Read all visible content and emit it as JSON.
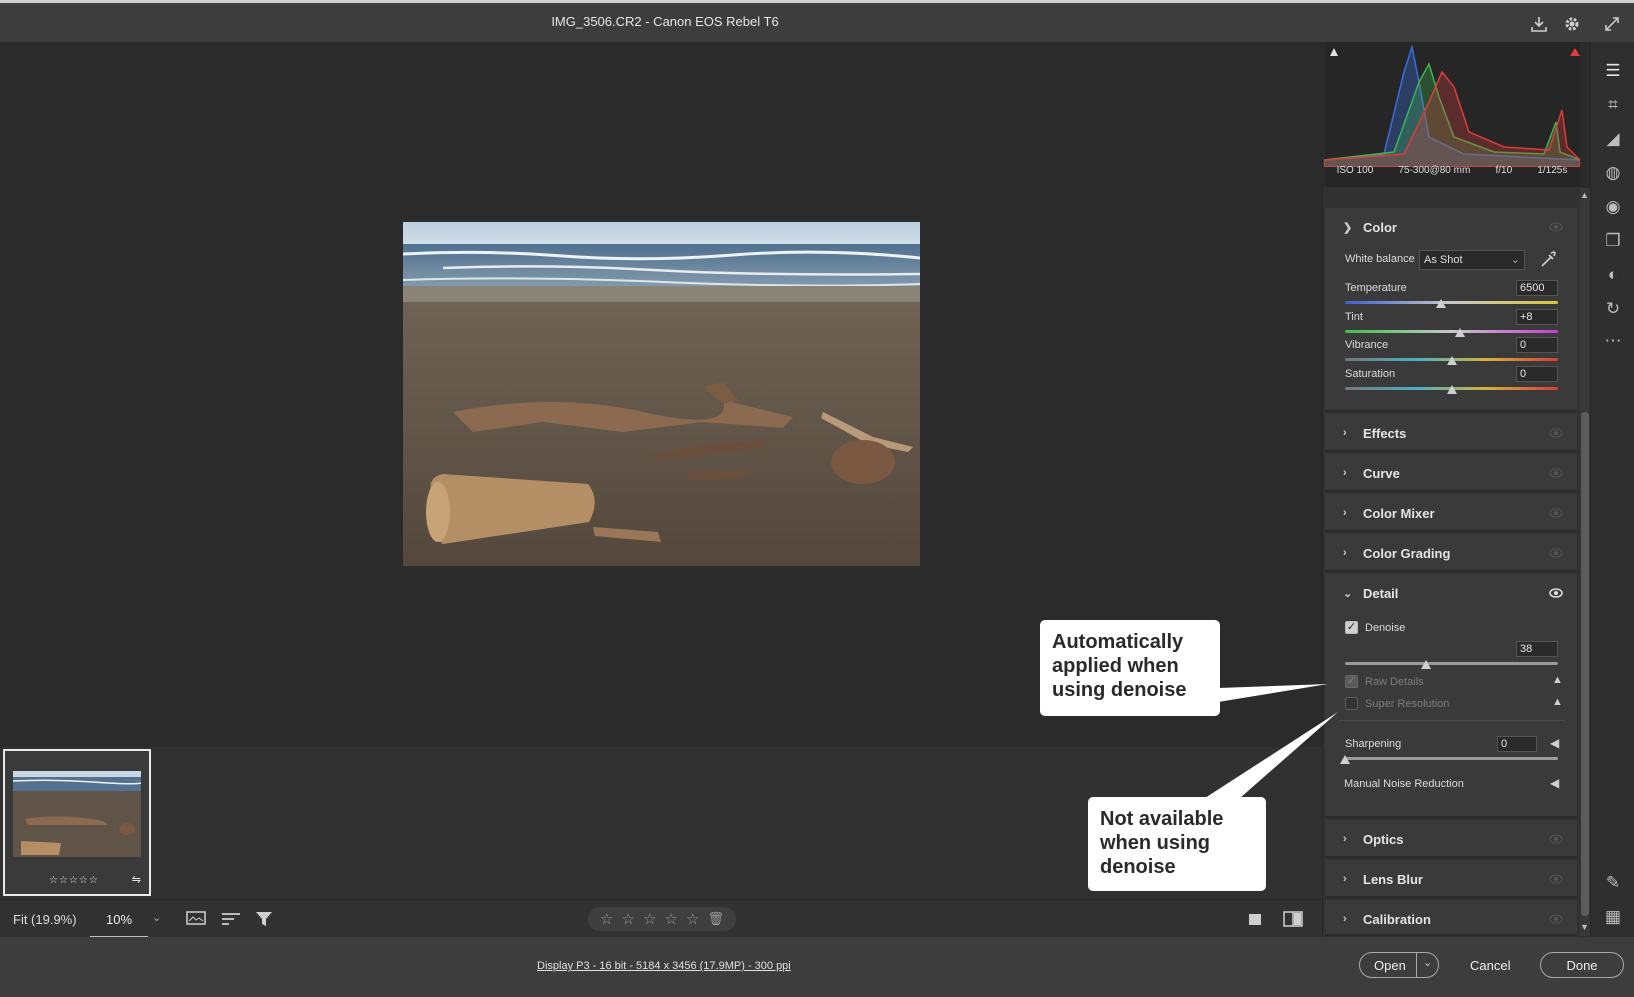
{
  "window": {
    "title": "IMG_3506.CR2  -  Canon EOS Rebel T6"
  },
  "titlebar_icons": [
    "save-icon",
    "gear-icon",
    "expand-icon"
  ],
  "histogram": {
    "exif": {
      "iso": "ISO 100",
      "lens": "75-300@80 mm",
      "aperture": "f/10",
      "shutter": "1/125s"
    }
  },
  "panels": {
    "color": {
      "title": "Color",
      "white_balance_label": "White balance",
      "white_balance_value": "As Shot",
      "temperature_label": "Temperature",
      "temperature_value": "6500",
      "tint_label": "Tint",
      "tint_value": "+8",
      "vibrance_label": "Vibrance",
      "vibrance_value": "0",
      "saturation_label": "Saturation",
      "saturation_value": "0"
    },
    "effects": "Effects",
    "curve": "Curve",
    "color_mixer": "Color Mixer",
    "color_grading": "Color Grading",
    "detail": {
      "title": "Detail",
      "denoise_label": "Denoise",
      "denoise_value": "38",
      "raw_details_label": "Raw Details",
      "super_resolution_label": "Super Resolution",
      "sharpening_label": "Sharpening",
      "sharpening_value": "0",
      "manual_noise_label": "Manual Noise Reduction"
    },
    "optics": "Optics",
    "lens_blur": "Lens Blur",
    "calibration": "Calibration"
  },
  "sliders": {
    "temperature": 0.45,
    "tint": 0.54,
    "vibrance": 0.5,
    "saturation": 0.5,
    "denoise": 0.38,
    "sharpening": 0.0
  },
  "callouts": {
    "first": "Automatically applied when using denoise",
    "second": "Not available when using denoise"
  },
  "bottom": {
    "fit": "Fit (19.9%)",
    "zoom": "10%"
  },
  "status": {
    "info": "Display P3 - 16 bit - 5184 x 3456 (17.9MP) - 300 ppi",
    "open": "Open",
    "cancel": "Cancel",
    "done": "Done"
  },
  "colors": {
    "background": "#2b2b2b",
    "panel": "#3a3a3a",
    "callout": "#ffffff",
    "accent_red": "#e23b3b"
  }
}
